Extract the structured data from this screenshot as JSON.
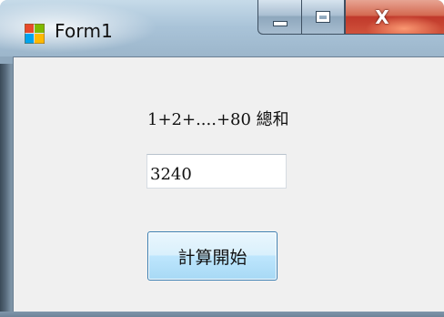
{
  "window": {
    "title": "Form1",
    "icon": "winforms-app-icon"
  },
  "caption_buttons": {
    "minimize_icon": "minimize-icon",
    "maximize_icon": "maximize-icon",
    "close_label": "X"
  },
  "form": {
    "sum_label": "1+2+....+80 總和",
    "result_value": "3240",
    "start_button_label": "計算開始"
  },
  "colors": {
    "client_background": "#f0f0f0",
    "button_border": "#3c7fb1",
    "close_red": "#c0392b"
  }
}
